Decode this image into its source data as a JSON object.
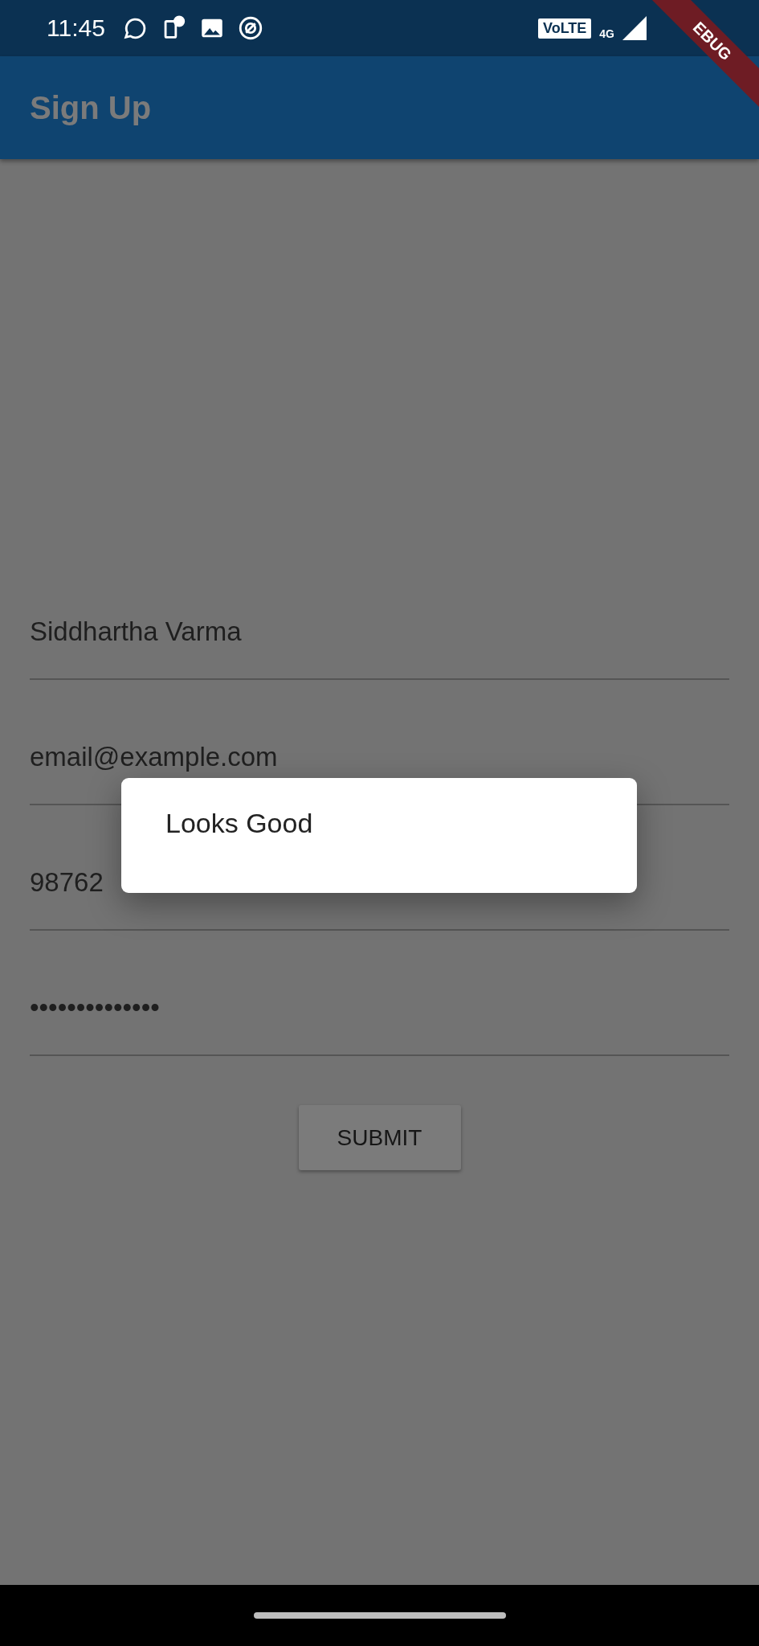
{
  "status_bar": {
    "time": "11:45",
    "volte": "VoLTE",
    "network": "4G"
  },
  "debug_banner": "EBUG",
  "app_bar": {
    "title": "Sign Up"
  },
  "fields": [
    {
      "value": "Siddhartha Varma"
    },
    {
      "value": "email@example.com"
    },
    {
      "value": "98762"
    },
    {
      "value": "••••••••••••••"
    }
  ],
  "submit_button": "SUBMIT",
  "dialog": {
    "message": "Looks Good"
  }
}
